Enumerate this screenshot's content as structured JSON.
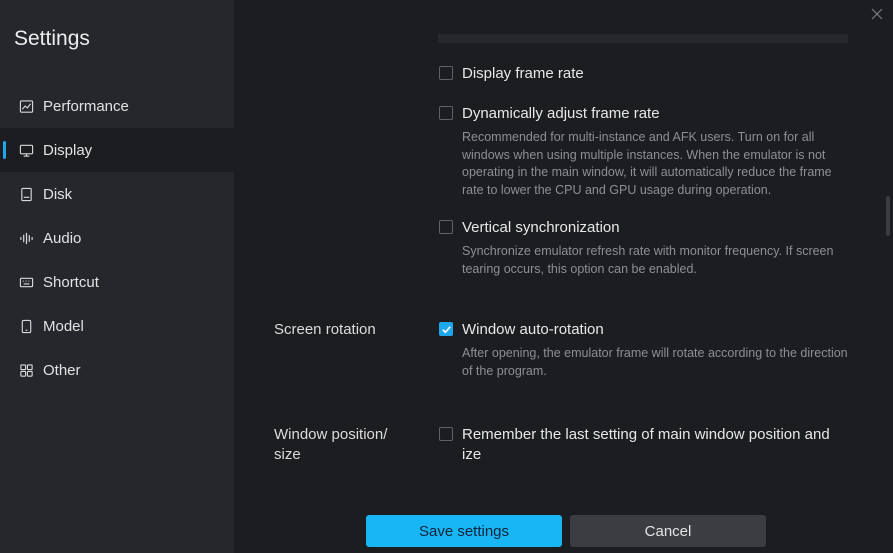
{
  "sidebar": {
    "title": "Settings",
    "items": [
      {
        "label": "Performance",
        "icon": "chart-line-icon"
      },
      {
        "label": "Display",
        "icon": "monitor-icon",
        "active": true
      },
      {
        "label": "Disk",
        "icon": "disk-icon"
      },
      {
        "label": "Audio",
        "icon": "audio-wave-icon"
      },
      {
        "label": "Shortcut",
        "icon": "keyboard-icon"
      },
      {
        "label": "Model",
        "icon": "phone-icon"
      },
      {
        "label": "Other",
        "icon": "grid-icon"
      }
    ]
  },
  "main": {
    "options": {
      "display_frame_rate": {
        "label": "Display frame rate",
        "checked": false
      },
      "dynamic_frame_rate": {
        "label": "Dynamically adjust frame rate",
        "checked": false,
        "description": "Recommended for multi-instance and AFK users. Turn on for all windows when using multiple instances. When the emulator is not operating in the main window, it will automatically reduce the frame rate to lower the CPU and GPU usage during operation."
      },
      "vsync": {
        "label": "Vertical synchronization",
        "checked": false,
        "description": "Synchronize emulator refresh rate with monitor frequency. If screen tearing occurs, this option can be enabled."
      },
      "auto_rotation": {
        "section_label": "Screen rotation",
        "label": "Window auto-rotation",
        "checked": true,
        "description": "After opening, the emulator frame will rotate according to the direction of the program."
      },
      "remember_position": {
        "section_label_line1": "Window position/",
        "section_label_line2": "size",
        "label_line1": "Remember the last setting of main window position and",
        "label_line2": "ize",
        "checked": false
      }
    }
  },
  "footer": {
    "save_label": "Save settings",
    "cancel_label": "Cancel"
  },
  "colors": {
    "accent": "#1fa7ee",
    "background": "#1c1d21",
    "sidebar": "#25272c"
  }
}
